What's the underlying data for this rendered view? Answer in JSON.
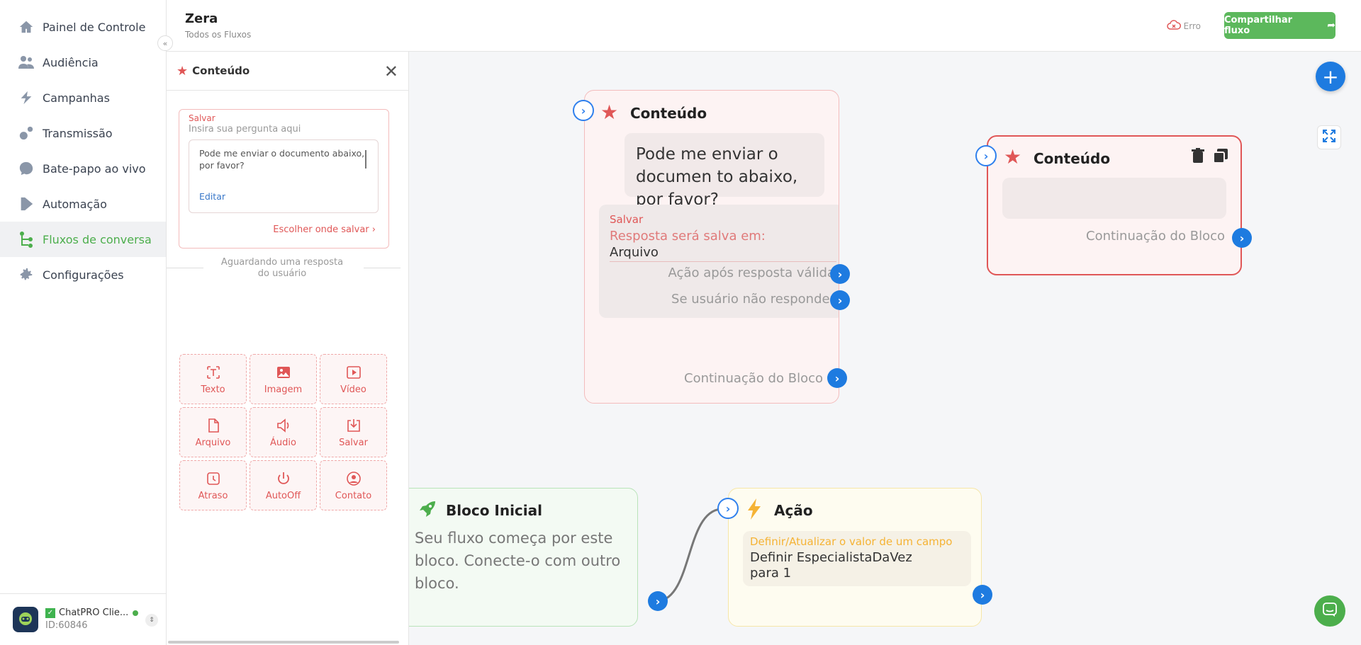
{
  "sidebar": {
    "items": [
      {
        "label": "Painel de Controle",
        "icon": "home-icon"
      },
      {
        "label": "Audiência",
        "icon": "users-icon"
      },
      {
        "label": "Campanhas",
        "icon": "campaign-icon"
      },
      {
        "label": "Transmissão",
        "icon": "broadcast-icon"
      },
      {
        "label": "Bate-papo ao vivo",
        "icon": "chat-icon"
      },
      {
        "label": "Automação",
        "icon": "automation-icon"
      },
      {
        "label": "Fluxos de conversa",
        "icon": "flow-icon"
      },
      {
        "label": "Configurações",
        "icon": "gear-icon"
      }
    ],
    "active_index": 6,
    "account": {
      "name": "ChatPRO Clie...",
      "id": "ID:60846"
    }
  },
  "header": {
    "title": "Zera",
    "breadcrumb": "Todos os Fluxos",
    "status": "Erro",
    "share_label": "Compartilhar fluxo"
  },
  "panel": {
    "title": "Conteúdo",
    "question": {
      "save_label": "Salvar",
      "placeholder": "Insira sua pergunta aqui",
      "text": "Pode me enviar o documento abaixo, por favor?",
      "edit_label": "Editar",
      "choose_label": "Escolher onde salvar"
    },
    "waiting_text": "Aguardando uma resposta do usuário",
    "tiles": [
      {
        "label": "Texto",
        "icon": "text-icon"
      },
      {
        "label": "Imagem",
        "icon": "image-icon"
      },
      {
        "label": "Vídeo",
        "icon": "video-icon"
      },
      {
        "label": "Arquivo",
        "icon": "file-icon"
      },
      {
        "label": "Áudio",
        "icon": "audio-icon"
      },
      {
        "label": "Salvar",
        "icon": "save-icon"
      },
      {
        "label": "Atraso",
        "icon": "delay-icon"
      },
      {
        "label": "AutoOff",
        "icon": "power-icon"
      },
      {
        "label": "Contato",
        "icon": "contact-icon"
      }
    ]
  },
  "canvas": {
    "content_node": {
      "title": "Conteúdo",
      "message": "Pode me enviar o documen to abaixo, por favor?",
      "save_label": "Salvar",
      "response_label": "Resposta será salva em:",
      "response_value": "Arquivo",
      "valid_action": "Ação após resposta válida",
      "no_response": "Se usuário não responder",
      "continuation": "Continuação do Bloco"
    },
    "content_node_2": {
      "title": "Conteúdo",
      "continuation": "Continuação do Bloco"
    },
    "start_node": {
      "title": "Bloco Inicial",
      "text": "Seu fluxo começa por este bloco. Conecte-o com outro bloco."
    },
    "action_node": {
      "title": "Ação",
      "action_label": "Definir/Atualizar o valor de um campo",
      "action_value": "Definir EspecialistaDaVez para 1"
    }
  },
  "colors": {
    "accent_green": "#5cb85c",
    "accent_blue": "#1e7be0",
    "content_red": "#e05757",
    "action_yellow": "#f5b335"
  }
}
